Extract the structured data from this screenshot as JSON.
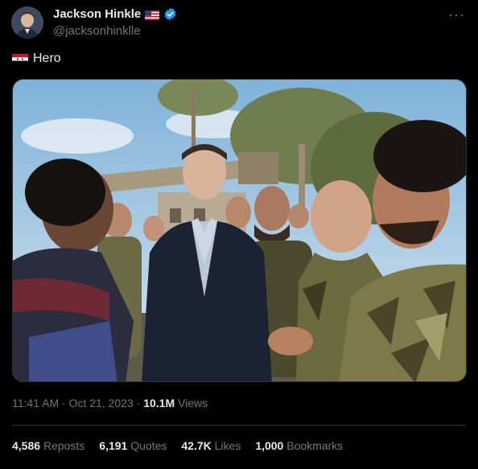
{
  "author": {
    "name": "Jackson Hinkle",
    "handle": "@jacksonhinklle",
    "name_flag_icon": "us-flag-icon",
    "verified_icon": "verified-badge-icon",
    "verified_color": "#1d9bf0"
  },
  "menu": {
    "more_label": "···"
  },
  "tweet": {
    "flag_icon": "syria-flag-icon",
    "text": "Hero"
  },
  "meta": {
    "time": "11:41 AM",
    "sep1": "·",
    "date": "Oct 21, 2023",
    "sep2": "·",
    "views_count": "10.1M",
    "views_label": "Views"
  },
  "stats": [
    {
      "count": "4,586",
      "label": "Reposts"
    },
    {
      "count": "6,191",
      "label": "Quotes"
    },
    {
      "count": "42.7K",
      "label": "Likes"
    },
    {
      "count": "1,000",
      "label": "Bookmarks"
    }
  ],
  "colors": {
    "background": "#000000",
    "text": "#e7e9ea",
    "muted": "#71767b",
    "divider": "#2f3336"
  }
}
